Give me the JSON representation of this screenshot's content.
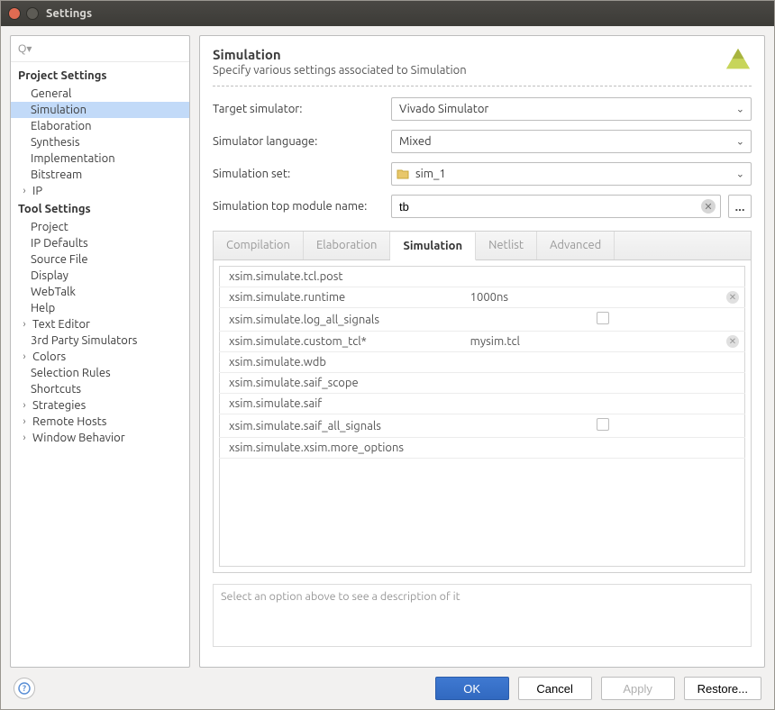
{
  "window": {
    "title": "Settings"
  },
  "search": {
    "placeholder": ""
  },
  "sidebar": {
    "group1_label": "Project Settings",
    "group1": {
      "i0": "General",
      "i1": "Simulation",
      "i2": "Elaboration",
      "i3": "Synthesis",
      "i4": "Implementation",
      "i5": "Bitstream",
      "i6": "IP"
    },
    "group2_label": "Tool Settings",
    "group2": {
      "i0": "Project",
      "i1": "IP Defaults",
      "i2": "Source File",
      "i3": "Display",
      "i4": "WebTalk",
      "i5": "Help",
      "i6": "Text Editor",
      "i7": "3rd Party Simulators",
      "i8": "Colors",
      "i9": "Selection Rules",
      "i10": "Shortcuts",
      "i11": "Strategies",
      "i12": "Remote Hosts",
      "i13": "Window Behavior"
    }
  },
  "header": {
    "title": "Simulation",
    "subtitle": "Specify various settings associated to Simulation"
  },
  "form": {
    "target_label": "Target simulator:",
    "target_value": "Vivado Simulator",
    "lang_label": "Simulator language:",
    "lang_value": "Mixed",
    "set_label": "Simulation set:",
    "set_value": "sim_1",
    "top_label": "Simulation top module name:",
    "top_value": "tb",
    "browse_label": "..."
  },
  "tabs": {
    "t0": "Compilation",
    "t1": "Elaboration",
    "t2": "Simulation",
    "t3": "Netlist",
    "t4": "Advanced"
  },
  "props": {
    "k0": "xsim.simulate.tcl.post",
    "v0": "",
    "k1": "xsim.simulate.runtime",
    "v1": "1000ns",
    "k2": "xsim.simulate.log_all_signals",
    "v2": "",
    "k3": "xsim.simulate.custom_tcl*",
    "v3": "mysim.tcl",
    "k4": "xsim.simulate.wdb",
    "v4": "",
    "k5": "xsim.simulate.saif_scope",
    "v5": "",
    "k6": "xsim.simulate.saif",
    "v6": "",
    "k7": "xsim.simulate.saif_all_signals",
    "v7": "",
    "k8": "xsim.simulate.xsim.more_options",
    "v8": ""
  },
  "description_hint": "Select an option above to see a description of it",
  "buttons": {
    "ok": "OK",
    "cancel": "Cancel",
    "apply": "Apply",
    "restore": "Restore..."
  },
  "icons": {
    "search": "🔍",
    "help": "?"
  }
}
